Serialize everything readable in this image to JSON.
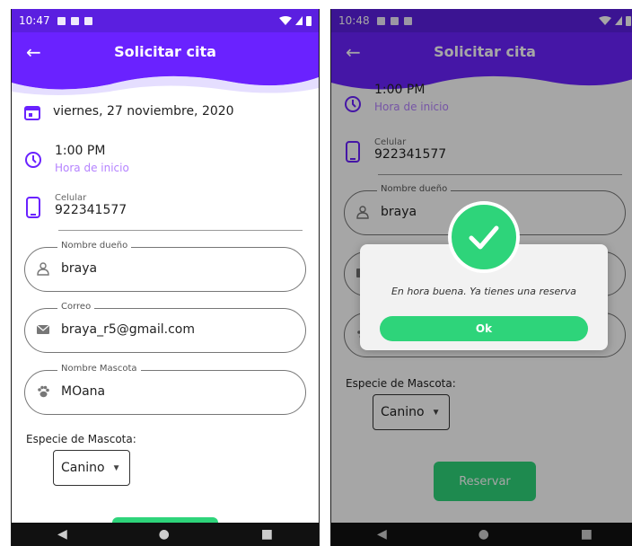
{
  "left": {
    "status": {
      "time": "10:47"
    },
    "appbar": {
      "back": "←",
      "title": "Solicitar cita"
    },
    "date": "viernes, 27 noviembre, 2020",
    "time": {
      "value": "1:00 PM",
      "label": "Hora de inicio"
    },
    "cel": {
      "label": "Celular",
      "value": "922341577"
    },
    "owner": {
      "label": "Nombre dueño",
      "value": "braya"
    },
    "email": {
      "label": "Correo",
      "value": "braya_r5@gmail.com"
    },
    "pet": {
      "label": "Nombre Mascota",
      "value": "MOana"
    },
    "species": {
      "label": "Especie de Mascota:",
      "value": "Canino"
    },
    "nav": {
      "back": "◀",
      "home": "●",
      "recents": "■"
    },
    "colors": {
      "statusbar": "#5b1fe0",
      "appbar": "#6a22ff",
      "accent": "#6a22ff",
      "sub": "#b583ff",
      "green": "#2ed47a"
    }
  },
  "right": {
    "status": {
      "time": "10:48"
    },
    "appbar": {
      "back": "←",
      "title": "Solicitar cita"
    },
    "time": {
      "value": "1:00 PM",
      "label": "Hora de inicio"
    },
    "cel": {
      "label": "Celular",
      "value": "922341577"
    },
    "owner": {
      "label": "Nombre dueño",
      "value": "braya"
    },
    "species": {
      "label": "Especie de Mascota:",
      "value": "Canino"
    },
    "reserve_label": "Reservar",
    "dialog": {
      "message": "En hora buena. Ya tienes una reserva",
      "ok": "Ok"
    },
    "nav": {
      "back": "◀",
      "home": "●",
      "recents": "■"
    }
  }
}
